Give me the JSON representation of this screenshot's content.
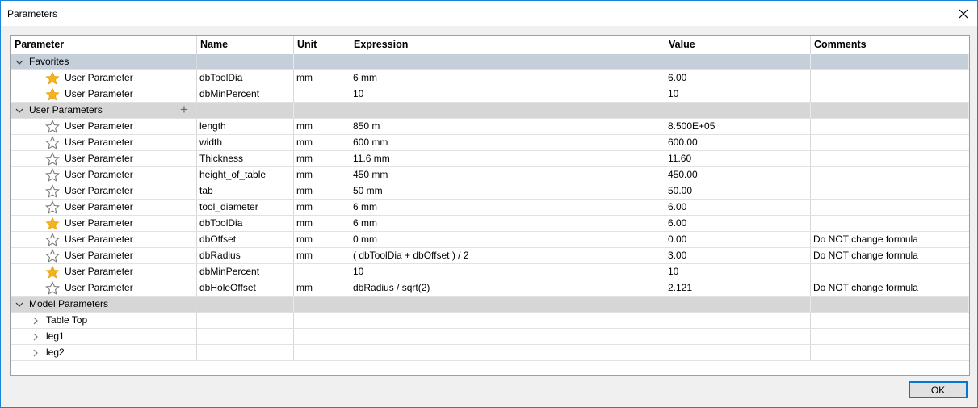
{
  "window": {
    "title": "Parameters"
  },
  "columns": [
    "Parameter",
    "Name",
    "Unit",
    "Expression",
    "Value",
    "Comments"
  ],
  "groups": {
    "favorites": {
      "label": "Favorites",
      "rows": [
        {
          "param": "User Parameter",
          "name": "dbToolDia",
          "unit": "mm",
          "expression": "6 mm",
          "value": "6.00",
          "comment": "",
          "favorite": true
        },
        {
          "param": "User Parameter",
          "name": "dbMinPercent",
          "unit": "",
          "expression": "10",
          "value": "10",
          "comment": "",
          "favorite": true
        }
      ]
    },
    "user": {
      "label": "User Parameters",
      "add_icon": "+",
      "rows": [
        {
          "param": "User Parameter",
          "name": "length",
          "unit": "mm",
          "expression": "850 m",
          "value": "8.500E+05",
          "comment": "",
          "favorite": false
        },
        {
          "param": "User Parameter",
          "name": "width",
          "unit": "mm",
          "expression": "600 mm",
          "value": "600.00",
          "comment": "",
          "favorite": false
        },
        {
          "param": "User Parameter",
          "name": "Thickness",
          "unit": "mm",
          "expression": "11.6 mm",
          "value": "11.60",
          "comment": "",
          "favorite": false
        },
        {
          "param": "User Parameter",
          "name": "height_of_table",
          "unit": "mm",
          "expression": "450 mm",
          "value": "450.00",
          "comment": "",
          "favorite": false
        },
        {
          "param": "User Parameter",
          "name": "tab",
          "unit": "mm",
          "expression": "50 mm",
          "value": "50.00",
          "comment": "",
          "favorite": false
        },
        {
          "param": "User Parameter",
          "name": "tool_diameter",
          "unit": "mm",
          "expression": "6 mm",
          "value": "6.00",
          "comment": "",
          "favorite": false
        },
        {
          "param": "User Parameter",
          "name": "dbToolDia",
          "unit": "mm",
          "expression": "6 mm",
          "value": "6.00",
          "comment": "",
          "favorite": true
        },
        {
          "param": "User Parameter",
          "name": "dbOffset",
          "unit": "mm",
          "expression": "0 mm",
          "value": "0.00",
          "comment": "Do NOT change formula",
          "favorite": false
        },
        {
          "param": "User Parameter",
          "name": "dbRadius",
          "unit": "mm",
          "expression": "( dbToolDia + dbOffset ) / 2",
          "value": "3.00",
          "comment": "Do NOT change formula",
          "favorite": false
        },
        {
          "param": "User Parameter",
          "name": "dbMinPercent",
          "unit": "",
          "expression": "10",
          "value": "10",
          "comment": "",
          "favorite": true
        },
        {
          "param": "User Parameter",
          "name": "dbHoleOffset",
          "unit": "mm",
          "expression": "dbRadius / sqrt(2)",
          "value": "2.121",
          "comment": "Do NOT change formula",
          "favorite": false
        }
      ]
    },
    "model": {
      "label": "Model Parameters",
      "children": [
        "Table Top",
        "leg1",
        "leg2"
      ]
    }
  },
  "buttons": {
    "ok": "OK"
  },
  "colors": {
    "star_filled": "#f5b21c",
    "star_outline": "#7a7a7a",
    "favorites_band": "#c5cfd9",
    "group_band": "#d6d6d6",
    "accent": "#0078d7"
  }
}
